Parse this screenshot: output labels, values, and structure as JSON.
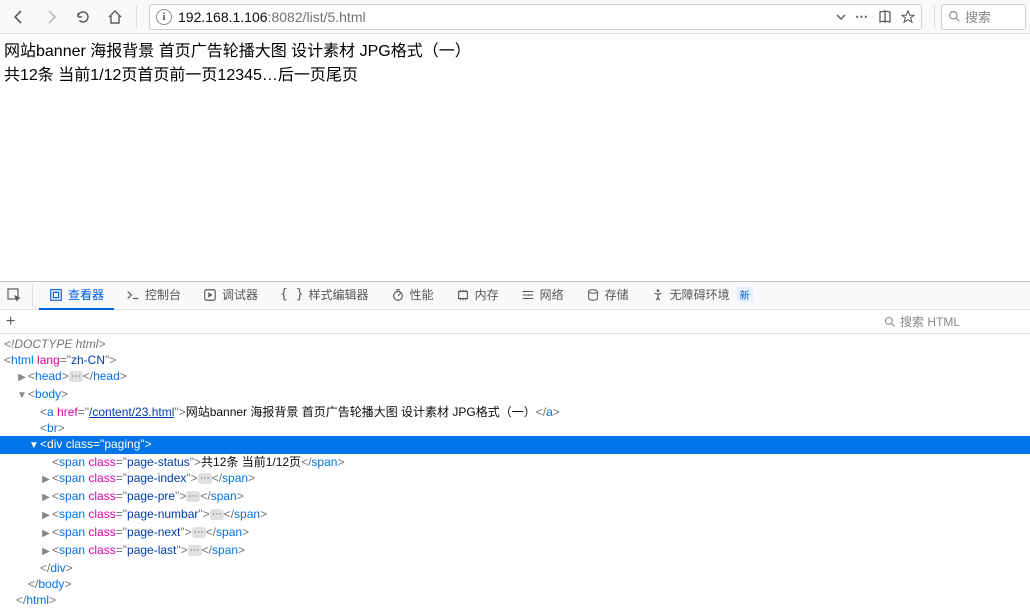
{
  "toolbar": {
    "url_host": "192.168.1.106",
    "url_port": ":8082",
    "url_path": "/list/5.html",
    "search_placeholder": "搜索"
  },
  "page": {
    "link_text": "网站banner 海报背景 首页广告轮播大图 设计素材 JPG格式（一）",
    "page_status": "共12条 当前1/12页",
    "page_index": "首页",
    "page_pre": "前一页",
    "page_numbers": "12345…",
    "page_next": "后一页",
    "page_last": "尾页"
  },
  "devtools": {
    "tabs": {
      "inspector": "查看器",
      "console": "控制台",
      "debugger": "调试器",
      "style": "样式编辑器",
      "performance": "性能",
      "memory": "内存",
      "network": "网络",
      "storage": "存储",
      "accessibility": "无障碍环境",
      "new_badge": "新"
    },
    "search_html": "搜索 HTML",
    "tree": {
      "doctype": "<!DOCTYPE html>",
      "html_attrs": "lang=\"zh-CN\"",
      "a_href": "/content/23.html",
      "a_text": "网站banner 海报背景 首页广告轮播大图 设计素材 JPG格式（一）",
      "paging_class": "paging",
      "span_status_text": "共12条 当前1/12页",
      "span_classes": {
        "status": "page-status",
        "index": "page-index",
        "pre": "page-pre",
        "numbar": "page-numbar",
        "next": "page-next",
        "last": "page-last"
      }
    }
  }
}
